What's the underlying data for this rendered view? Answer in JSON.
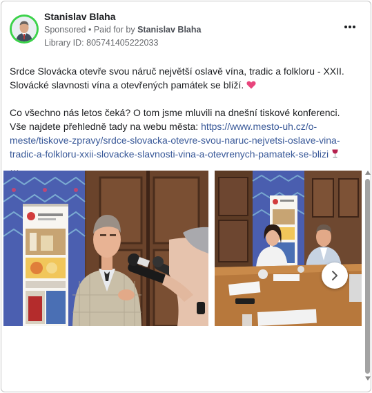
{
  "post": {
    "author": "Stanislav Blaha",
    "sponsored": "Sponsored",
    "paid_for_prefix": "Paid for by",
    "paid_for_by": "Stanislav Blaha",
    "library_id": "Library ID: 805741405222033",
    "more_label": "More options",
    "paragraph1": "Srdce Slovácka otevře svou náruč největší oslavě vína, tradic a folkloru - XXII. Slovácké slavnosti vína a otevřených památek se blíží.",
    "paragraph2_prefix": "Co všechno nás letos čeká? O tom jsme mluvili na dnešní tiskové konferenci. Vše najdete přehledně tady na webu města: ",
    "link": "https://www.mesto-uh.cz/o-meste/tiskove-zpravy/srdce-slovacka-otevre-svou-naruc-nejvetsi-oslave-vina-tradic-a-folkloru-xxii-slovacke-slavnosti-vina-a-otevrenych-pamatek-se-blizi",
    "ellipsis": "…",
    "heart_emoji": "heart-icon",
    "wine_emoji": "wine-glass-icon"
  },
  "images": [
    {
      "name": "interview-photo",
      "banner_title": "Uherské Hradiště"
    },
    {
      "name": "press-conference-photo",
      "banner_title": "Uherské Hradiště"
    }
  ],
  "colors": {
    "link": "#385898",
    "avatar_ring": "#3bd24a",
    "muted": "#65676b"
  }
}
